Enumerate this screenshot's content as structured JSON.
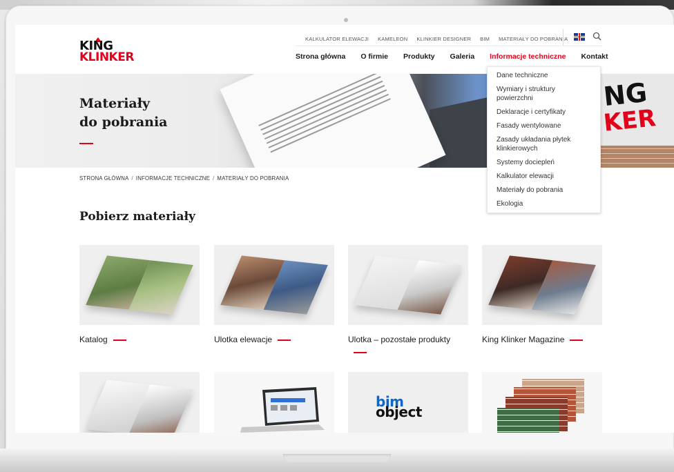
{
  "logo": {
    "line1": "KING",
    "line2": "KLINKER"
  },
  "topbar": {
    "links": [
      "KALKULATOR ELEWACJI",
      "KAMELEON",
      "KLINKIER DESIGNER",
      "BIM",
      "MATERIAŁY DO POBRANIA"
    ],
    "language_icon": "uk-flag-icon",
    "search_icon": "search-icon"
  },
  "nav": {
    "items": [
      "Strona główna",
      "O firmie",
      "Produkty",
      "Galeria",
      "Informacje techniczne",
      "Kontakt"
    ],
    "active": "Informacje techniczne"
  },
  "dropdown": {
    "items": [
      "Dane techniczne",
      "Wymiary i struktury powierzchni",
      "Deklaracje i certyfikaty",
      "Fasady wentylowane",
      "Zasady układania płytek klinkierowych",
      "Systemy dociepleń",
      "Kalkulator elewacji",
      "Materiały do pobrania",
      "Ekologia"
    ]
  },
  "hero": {
    "title_line1": "Materiały",
    "title_line2": "do pobrania",
    "sign_line1": "NG",
    "sign_line2": "KER"
  },
  "breadcrumb": [
    "STRONA GŁÓWNA",
    "INFORMACJE TECHNICZNE",
    "MATERIAŁY DO POBRANIA"
  ],
  "section_title": "Pobierz materiały",
  "cards": [
    {
      "title": "Katalog"
    },
    {
      "title": "Ulotka elewacje"
    },
    {
      "title": "Ulotka – pozostałe produkty"
    },
    {
      "title": "King Klinker Magazine"
    }
  ],
  "bim_logo": {
    "line1": "bim",
    "line2": "object"
  },
  "colors": {
    "accent": "#e2001a",
    "text": "#1b1b1b"
  }
}
